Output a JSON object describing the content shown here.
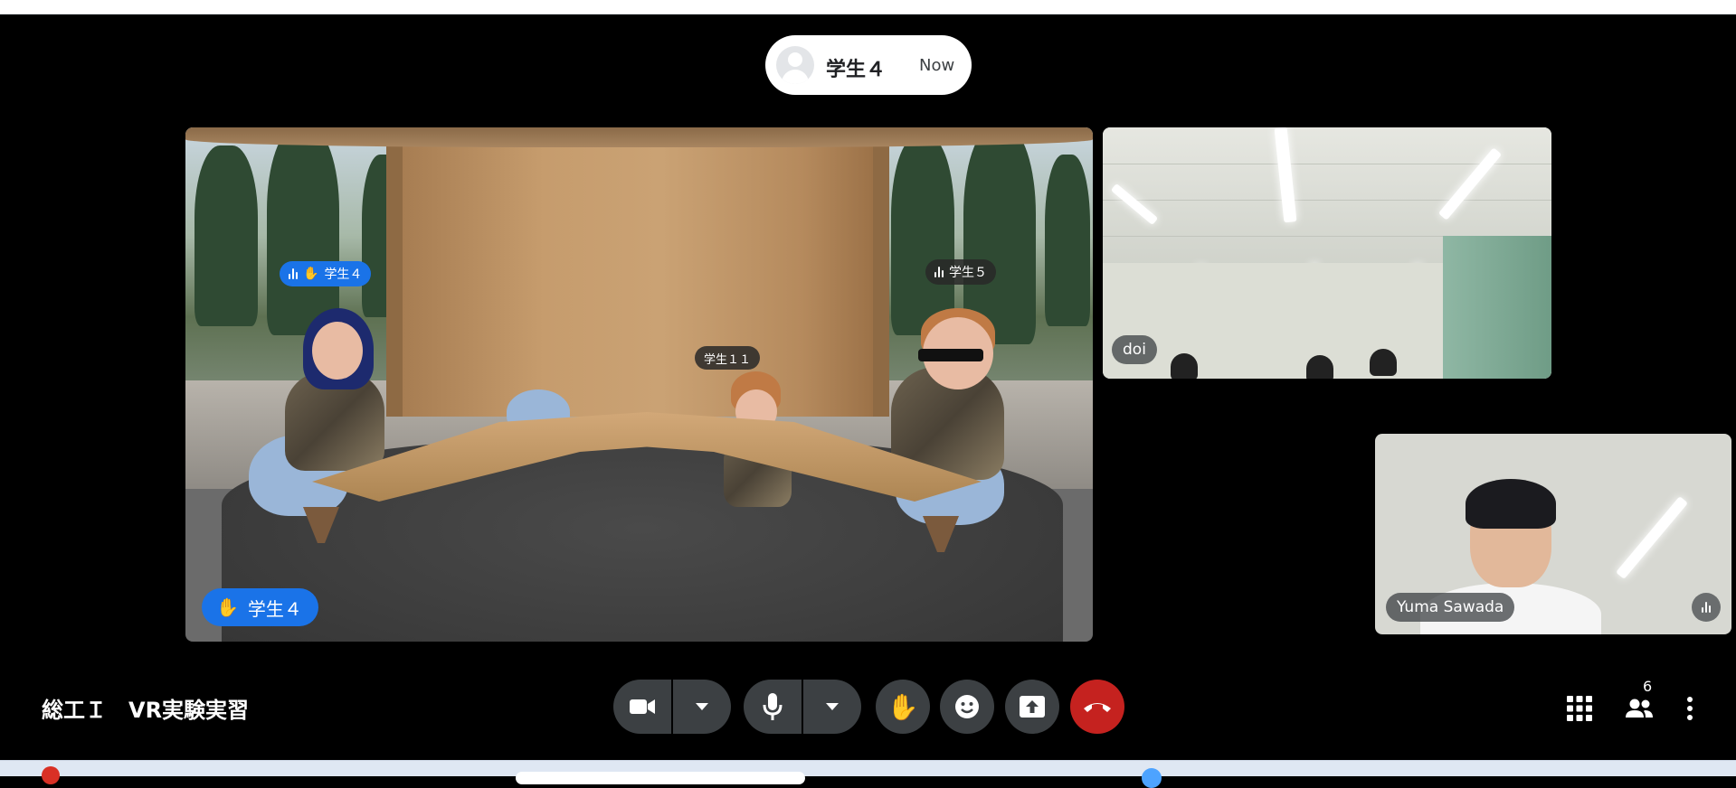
{
  "active_speaker": {
    "name": "学生４",
    "time": "Now"
  },
  "main_tile": {
    "labels": [
      {
        "name": "学生４",
        "raised_hand": true,
        "speaking": true
      },
      {
        "name": "学生５",
        "raised_hand": false,
        "speaking": true
      },
      {
        "name": "学生１１",
        "raised_hand": false,
        "speaking": false
      }
    ],
    "raised_hand_badge": "学生４"
  },
  "tiles": {
    "doi": {
      "name": "doi"
    },
    "self": {
      "name": "Yuma Sawada"
    }
  },
  "meeting": {
    "title": "総工Ｉ　VR実験実習"
  },
  "controls": {
    "camera": "camera-icon",
    "camera_options": "chevron-down-icon",
    "mic": "mic-icon",
    "mic_options": "chevron-down-icon",
    "raise_hand": "hand-icon",
    "reactions": "emoji-icon",
    "present": "present-icon",
    "leave": "hangup-icon"
  },
  "right_controls": {
    "apps": "grid-icon",
    "people": "people-icon",
    "people_count": "6",
    "more": "more-vert-icon"
  },
  "colors": {
    "accent_blue": "#1a73e8",
    "control_bg": "#3c4043",
    "leave_red": "#c5221f"
  }
}
